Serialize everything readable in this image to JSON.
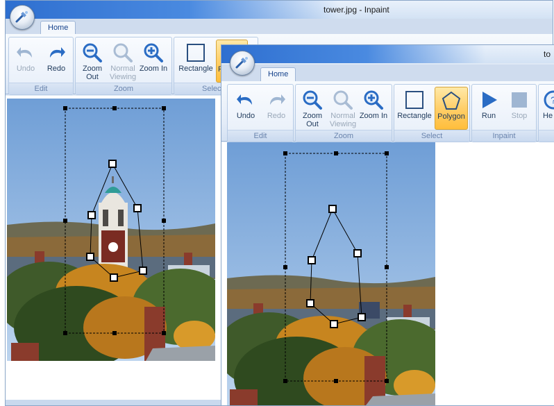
{
  "back_window": {
    "title": "tower.jpg - Inpaint",
    "tab": "Home",
    "groups": {
      "edit": "Edit",
      "zoom": "Zoom",
      "select": "Select"
    },
    "buttons": {
      "undo": "Undo",
      "redo": "Redo",
      "zoom_out": "Zoom Out",
      "normal_viewing": "Normal Viewing",
      "zoom_in": "Zoom In",
      "rectangle": "Rectangle",
      "polygon": "Po"
    }
  },
  "front_window": {
    "title": "to",
    "tab": "Home",
    "groups": {
      "edit": "Edit",
      "zoom": "Zoom",
      "select": "Select",
      "inpaint": "Inpaint"
    },
    "buttons": {
      "undo": "Undo",
      "redo": "Redo",
      "zoom_out": "Zoom Out",
      "normal_viewing": "Normal Viewing",
      "zoom_in": "Zoom In",
      "rectangle": "Rectangle",
      "polygon": "Polygon",
      "run": "Run",
      "stop": "Stop",
      "help": "He"
    }
  },
  "colors": {
    "accent_blue": "#2a6cc4",
    "active_button": "#ffcf6a",
    "sky": "#8fb4df",
    "foliage_orange": "#d08a22"
  }
}
